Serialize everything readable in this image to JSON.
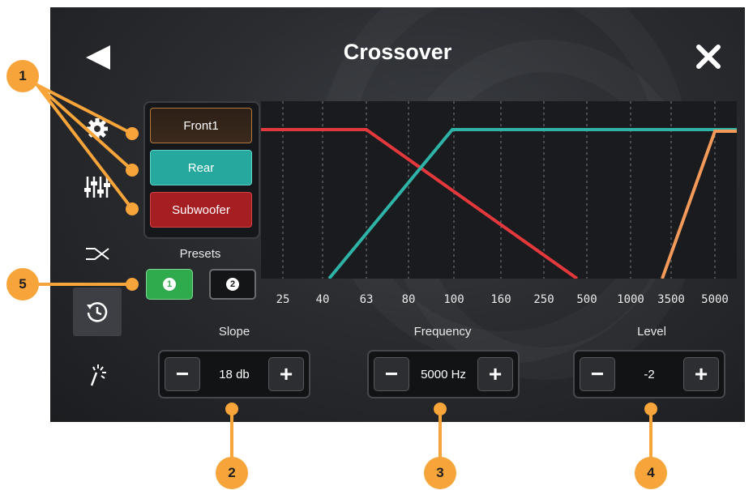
{
  "header": {
    "title": "Crossover",
    "back_icon": "back-arrow-icon",
    "close_icon": "close-icon"
  },
  "sidebar": {
    "items": [
      {
        "name": "settings",
        "icon": "gear-icon"
      },
      {
        "name": "equalizer",
        "icon": "equalizer-sliders-icon"
      },
      {
        "name": "crossover",
        "icon": "crossover-icon"
      },
      {
        "name": "delay",
        "icon": "clock-icon",
        "active": true
      },
      {
        "name": "effects",
        "icon": "magic-wand-icon"
      }
    ]
  },
  "channels": [
    {
      "label": "Front1",
      "color": "#3b2a1c"
    },
    {
      "label": "Rear",
      "color": "#27a89e"
    },
    {
      "label": "Subwoofer",
      "color": "#a51e22"
    }
  ],
  "presets": {
    "label": "Presets",
    "items": [
      "1",
      "2"
    ],
    "selected": "1"
  },
  "graph": {
    "x_ticks": [
      "25",
      "40",
      "63",
      "80",
      "100",
      "160",
      "250",
      "500",
      "1000",
      "3500",
      "5000"
    ],
    "lines": [
      {
        "name": "Subwoofer",
        "color": "#e3383c"
      },
      {
        "name": "Rear",
        "color": "#2fb3a7"
      },
      {
        "name": "Front1",
        "color": "#f39a5a"
      }
    ]
  },
  "controls": {
    "slope": {
      "label": "Slope",
      "value": "18 db",
      "minus": "−",
      "plus": "+"
    },
    "frequency": {
      "label": "Frequency",
      "value": "5000 Hz",
      "minus": "−",
      "plus": "+"
    },
    "level": {
      "label": "Level",
      "value": "-2",
      "minus": "−",
      "plus": "+"
    }
  },
  "callouts": [
    "1",
    "2",
    "3",
    "4",
    "5"
  ],
  "colors": {
    "accent": "#f7a43a",
    "active_preset": "#2faa4d"
  }
}
